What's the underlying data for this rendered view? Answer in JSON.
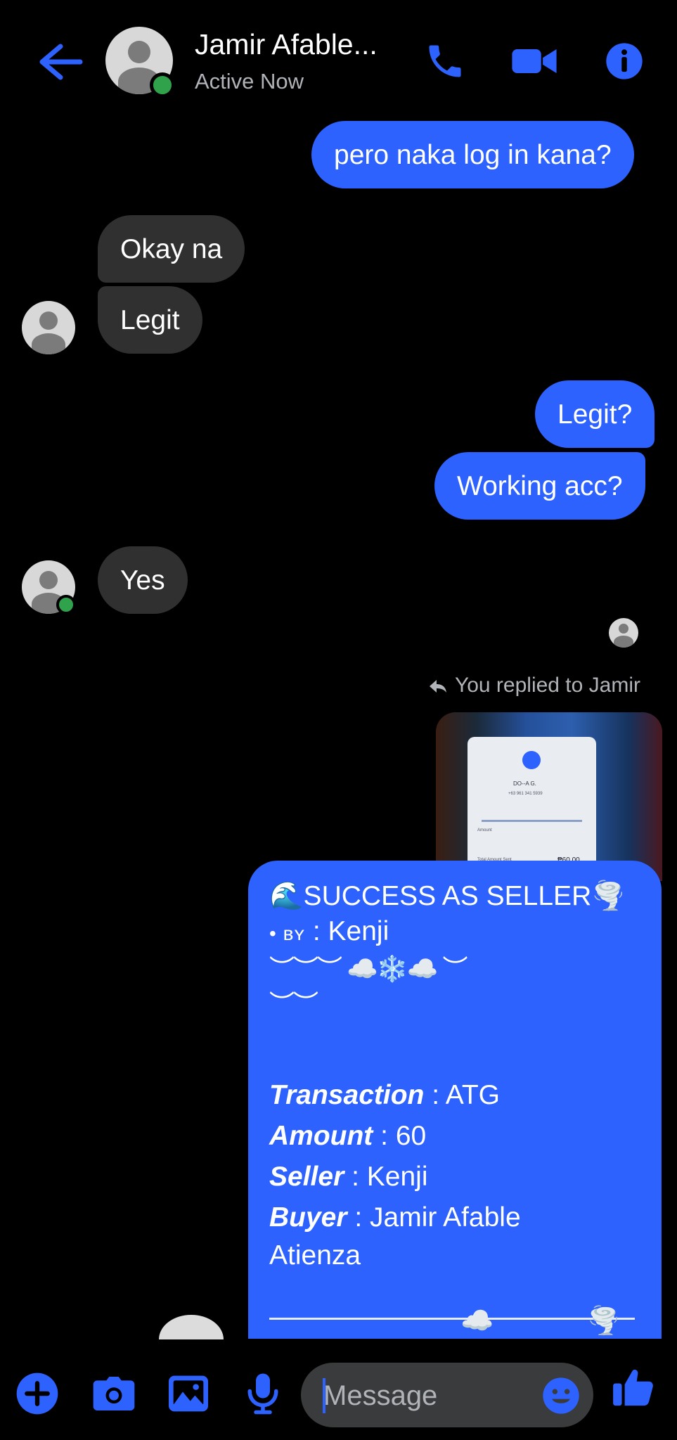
{
  "header": {
    "contact_name": "Jamir Afable...",
    "status": "Active Now",
    "icons": [
      "back-arrow-icon",
      "phone-icon",
      "video-camera-icon",
      "info-icon"
    ],
    "accent_color": "#2d62ff",
    "online_color": "#31a24c"
  },
  "messages": [
    {
      "direction": "outgoing",
      "text": "pero naka log in kana?"
    },
    {
      "direction": "incoming",
      "text": "Okay na"
    },
    {
      "direction": "incoming",
      "text": "Legit"
    },
    {
      "direction": "outgoing",
      "text": "Legit?"
    },
    {
      "direction": "outgoing",
      "text": "Working acc?"
    },
    {
      "direction": "incoming",
      "text": "Yes"
    }
  ],
  "reply_note": "You replied to Jamir",
  "photo_card": {
    "name": "DO--A G.",
    "phone": "+63 961 341 5939",
    "amount_label": "Amount",
    "total_label": "Total Amount Sent",
    "total_value": "₱60.00"
  },
  "success_message": {
    "title": "🌊SUCCESS AS SELLER🌪️",
    "by_prefix": "• ʙʏ",
    "by_value": " : Kenji",
    "decor_1": "︶︶︶ ☁️❄️☁️ ︶",
    "decor_2": "︶︶",
    "fields": [
      {
        "label": "Transaction",
        "value": " : ATG"
      },
      {
        "label": "Amount",
        "value": " : 60"
      },
      {
        "label": "Seller",
        "value": " : Kenji"
      },
      {
        "label": "Buyer",
        "value": " : Jamir Afable"
      }
    ],
    "buyer_continuation": "Atienza",
    "divider_emoji_1": "☁️",
    "divider_emoji_2": "🌪️"
  },
  "composer": {
    "placeholder": "Message",
    "icons": [
      "plus-icon",
      "camera-icon",
      "gallery-icon",
      "microphone-icon",
      "emoji-icon",
      "thumbs-up-icon"
    ]
  }
}
